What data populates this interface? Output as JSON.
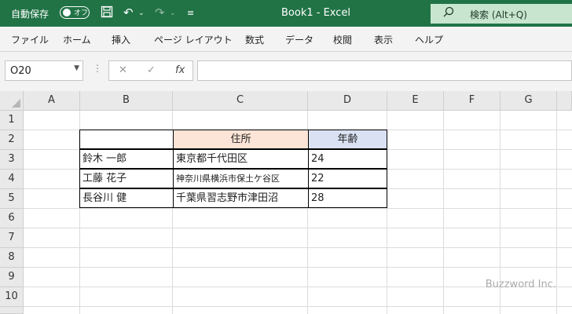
{
  "titlebar": {
    "autosave_label": "自動保存",
    "autosave_toggle": "オフ",
    "title": "Book1  -  Excel",
    "search_placeholder": "検索 (Alt+Q)"
  },
  "ribbon": {
    "tabs": [
      "ファイル",
      "ホーム",
      "挿入",
      "ページ レイアウト",
      "数式",
      "データ",
      "校閲",
      "表示",
      "ヘルプ"
    ]
  },
  "formula_bar": {
    "name_box": "O20",
    "fx_label": "fx",
    "value": ""
  },
  "sheet": {
    "columns": [
      "A",
      "B",
      "C",
      "D",
      "E",
      "F",
      "G"
    ],
    "rows": [
      "1",
      "2",
      "3",
      "4",
      "5",
      "6",
      "7",
      "8",
      "9",
      "10"
    ],
    "table": {
      "headers": [
        "",
        "住所",
        "年齢"
      ],
      "header_colors": [
        "#ffffff",
        "#fce4d6",
        "#d9e1f2"
      ],
      "rows": [
        [
          "鈴木 一郎",
          "東京都千代田区",
          "24"
        ],
        [
          "工藤 花子",
          "神奈川県横浜市保土ケ谷区",
          "22"
        ],
        [
          "長谷川 健",
          "千葉県習志野市津田沼",
          "28"
        ]
      ]
    }
  },
  "watermark": "Buzzword Inc.",
  "colors": {
    "accent": "#217346"
  }
}
